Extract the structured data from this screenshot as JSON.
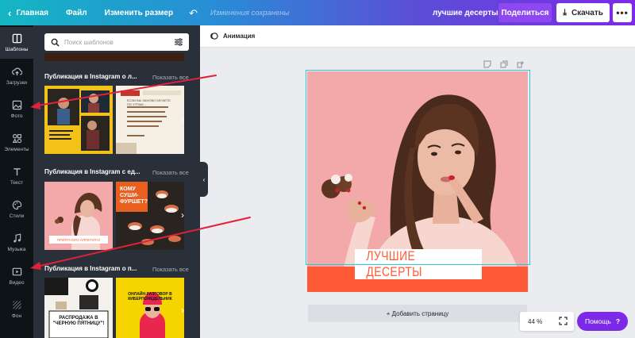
{
  "topbar": {
    "home": "Главная",
    "file": "Файл",
    "resize": "Изменить размер",
    "saved_status": "Изменения сохранены",
    "document_name": "лучшие десерты",
    "share": "Поделиться",
    "download": "Скачать"
  },
  "rail": [
    {
      "label": "Шаблоны",
      "icon": "templates-icon"
    },
    {
      "label": "Загрузки",
      "icon": "upload-icon"
    },
    {
      "label": "Фото",
      "icon": "photo-icon"
    },
    {
      "label": "Элементы",
      "icon": "elements-icon"
    },
    {
      "label": "Текст",
      "icon": "text-icon"
    },
    {
      "label": "Стили",
      "icon": "palette-icon"
    },
    {
      "label": "Музыка",
      "icon": "music-icon"
    },
    {
      "label": "Видео",
      "icon": "video-icon"
    },
    {
      "label": "Фон",
      "icon": "background-icon"
    }
  ],
  "search": {
    "placeholder": "Поиск шаблонов"
  },
  "sections": [
    {
      "title": "Публикация в Instagram о л...",
      "show_all": "Показать все",
      "thumb_texts": [
        "ЕСЛИ ВЫ ЗАНОВО БЕГАЕТЕ ПО УТРАМ..."
      ]
    },
    {
      "title": "Публикация в Instagram с ед...",
      "show_all": "Показать все",
      "thumb_texts": [
        "ПРИЯТНОГО АППЕТИТА!",
        "КОМУ СУШИ-ФУРШЕТ?"
      ]
    },
    {
      "title": "Публикация в Instagram о п...",
      "show_all": "Показать все",
      "thumb_texts": [
        "РАСПРОДАЖА В \"ЧЕРНУЮ ПЯТНИЦУ\"!",
        "ОНЛАЙН-РАЗГОВОР В КИБЕРПОНЕДЕЛЬНИК"
      ]
    }
  ],
  "canvas": {
    "toolbar_label": "Анимация",
    "design_title": "ЛУЧШИЕ ДЕСЕРТЫ",
    "add_page": "+ Добавить страницу",
    "zoom": "44 %",
    "help": "Помощь",
    "help_glyph": "?"
  },
  "colors": {
    "accent": "#7d2ae8",
    "design_bg": "#f3a9aa",
    "design_band": "#ff5a36",
    "selection": "#2ec6d8",
    "annotation_arrow": "#e0233b"
  }
}
